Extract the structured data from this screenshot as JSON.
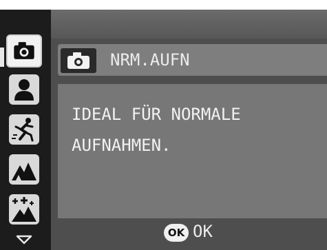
{
  "sidebar": {
    "modes": [
      {
        "icon": "camera-icon",
        "selected": true
      },
      {
        "icon": "portrait-icon",
        "selected": false
      },
      {
        "icon": "sports-icon",
        "selected": false
      },
      {
        "icon": "landscape-icon",
        "selected": false
      },
      {
        "icon": "night-landscape-icon",
        "selected": false
      }
    ],
    "scroll_icon": "chevron-down-icon"
  },
  "header": {
    "icon": "camera-icon",
    "title": "NRM.AUFN"
  },
  "description": {
    "line1": "IDEAL FÜR NORMALE",
    "line2": "AUFNAHMEN."
  },
  "footer": {
    "ok_badge": "OK",
    "ok_label": "OK"
  },
  "colors": {
    "sidebar_bg": "#1c1c1c",
    "panel_bg": "#777777",
    "title_bar_bg": "#7e7e7e",
    "text": "#f2f2f2"
  }
}
